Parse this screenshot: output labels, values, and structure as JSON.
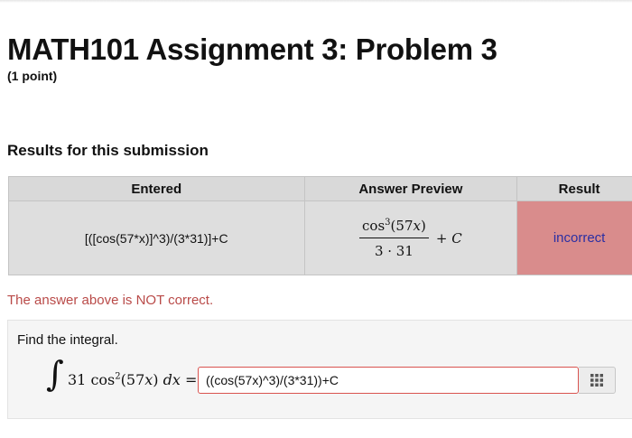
{
  "header": {
    "title": "MATH101 Assignment 3: Problem 3",
    "points": "(1 point)"
  },
  "results": {
    "heading": "Results for this submission",
    "columns": [
      "Entered",
      "Answer Preview",
      "Result"
    ],
    "row": {
      "entered": "[([cos(57*x)]^3)/(3*31)]+C",
      "preview": {
        "numerator_fn": "cos",
        "numerator_power": "3",
        "numerator_arg_open": "(57",
        "numerator_arg_var": "x",
        "numerator_arg_close": ")",
        "denominator": "3 · 31",
        "plus": "+",
        "constant": "C"
      },
      "result": "incorrect"
    },
    "result_color": "#d98c8c"
  },
  "feedback": {
    "message": "The answer above is NOT correct."
  },
  "problem": {
    "prompt": "Find the integral.",
    "integral_sign": "∫",
    "coefficient": "31",
    "fn": "cos",
    "power": "2",
    "arg_open": "(57",
    "arg_var": "x",
    "arg_close": ")",
    "differential": "dx",
    "equals": "=",
    "answer_value": "((cos(57x)^3)/(3*31))+C",
    "math_editor_icon": "grid-icon"
  }
}
